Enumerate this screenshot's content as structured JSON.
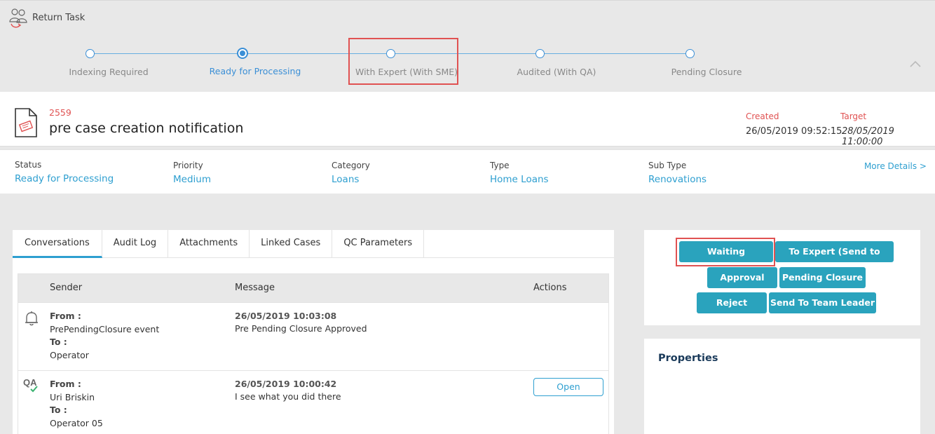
{
  "header": {
    "return_label": "Return Task"
  },
  "stepper": {
    "steps": [
      {
        "label": "Indexing Required"
      },
      {
        "label": "Ready for Processing"
      },
      {
        "label": "With Expert (With SME)"
      },
      {
        "label": "Audited (With QA)"
      },
      {
        "label": "Pending Closure"
      }
    ],
    "current_index": 1,
    "highlighted_index": 2
  },
  "case": {
    "id": "2559",
    "title": "pre case creation notification",
    "created_label": "Created",
    "target_label": "Target",
    "created_value": "26/05/2019 09:52:15",
    "target_value": "28/05/2019 11:00:00"
  },
  "info": {
    "status_label": "Status",
    "status_value": "Ready for Processing",
    "priority_label": "Priority",
    "priority_value": "Medium",
    "category_label": "Category",
    "category_value": "Loans",
    "type_label": "Type",
    "type_value": "Home Loans",
    "subtype_label": "Sub Type",
    "subtype_value": "Renovations",
    "more_details": "More Details >"
  },
  "tabs": [
    "Conversations",
    "Audit Log",
    "Attachments",
    "Linked Cases",
    "QC Parameters"
  ],
  "table": {
    "headers": {
      "sender": "Sender",
      "message": "Message",
      "actions": "Actions"
    },
    "rows": [
      {
        "icon": "bell-icon",
        "from_label": "From :",
        "from": "PrePendingClosure event",
        "to_label": "To :",
        "to": "Operator",
        "timestamp": "26/05/2019 10:03:08",
        "message": "Pre Pending Closure Approved",
        "action": ""
      },
      {
        "icon": "qa-check-icon",
        "icon_text": "QA",
        "from_label": "From :",
        "from": "Uri Briskin",
        "to_label": "To :",
        "to": "Operator 05",
        "timestamp": "26/05/2019 10:00:42",
        "message": "I see what you did there",
        "action": "Open"
      }
    ]
  },
  "actions": {
    "waiting": "Waiting",
    "to_expert": "To Expert (Send to SME)",
    "approval": "Approval",
    "pending_closure": "Pending Closure",
    "reject": "Reject",
    "send_to_team_leader": "Send To Team Leader"
  },
  "properties": {
    "title": "Properties"
  },
  "colors": {
    "accent": "#2e9fd0",
    "button": "#2aa3bd",
    "alert": "#e05252"
  }
}
